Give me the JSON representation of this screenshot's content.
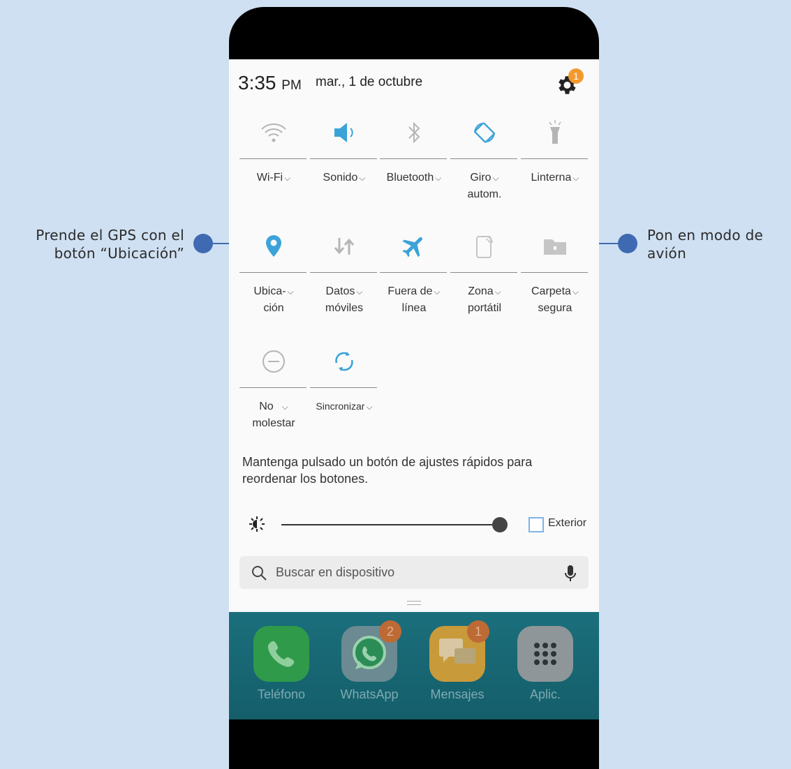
{
  "callouts": {
    "left": {
      "line1": "Prende el GPS con el",
      "line2": "botón “Ubicación”"
    },
    "right": {
      "line1": "Pon en modo de",
      "line2": "avión"
    }
  },
  "status": {
    "time": "3:35",
    "ampm": "PM",
    "date": "mar., 1 de octubre",
    "settings_badge": "1"
  },
  "tiles": [
    {
      "icon": "wifi-icon",
      "label1": "Wi-Fi",
      "label2": ""
    },
    {
      "icon": "sound-icon",
      "label1": "Sonido",
      "label2": ""
    },
    {
      "icon": "bluetooth-icon",
      "label1": "Bluetooth",
      "label2": ""
    },
    {
      "icon": "auto-rotate-icon",
      "label1": "Giro",
      "label2": "autom."
    },
    {
      "icon": "flashlight-icon",
      "label1": "Linterna",
      "label2": ""
    },
    {
      "icon": "location-icon",
      "label1": "Ubica-",
      "label2": "ción"
    },
    {
      "icon": "mobile-data-icon",
      "label1": "Datos",
      "label2": "móviles"
    },
    {
      "icon": "airplane-icon",
      "label1": "Fuera de",
      "label2": "línea"
    },
    {
      "icon": "hotspot-icon",
      "label1": "Zona",
      "label2": "portátil"
    },
    {
      "icon": "secure-folder-icon",
      "label1": "Carpeta",
      "label2": "segura"
    },
    {
      "icon": "do-not-disturb-icon",
      "label1": "No",
      "label2": "molestar"
    },
    {
      "icon": "sync-icon",
      "label1": "Sincronizar",
      "label2": ""
    }
  ],
  "hint": "Mantenga pulsado un botón de ajustes rápidos para reordenar los botones.",
  "brightness": {
    "level": 1.0,
    "outdoor_label": "Exterior",
    "outdoor_checked": false
  },
  "search": {
    "placeholder": "Buscar en dispositivo"
  },
  "dock": [
    {
      "name": "Teléfono",
      "icon": "phone-icon",
      "badge": ""
    },
    {
      "name": "WhatsApp",
      "icon": "whatsapp-icon",
      "badge": "2"
    },
    {
      "name": "Mensajes",
      "icon": "messages-icon",
      "badge": "1"
    },
    {
      "name": "Aplic.",
      "icon": "apps-grid-icon",
      "badge": ""
    }
  ],
  "colors": {
    "accent": "#3ba3d8",
    "callout": "#3f6ab2",
    "badge": "#f39a2e"
  }
}
